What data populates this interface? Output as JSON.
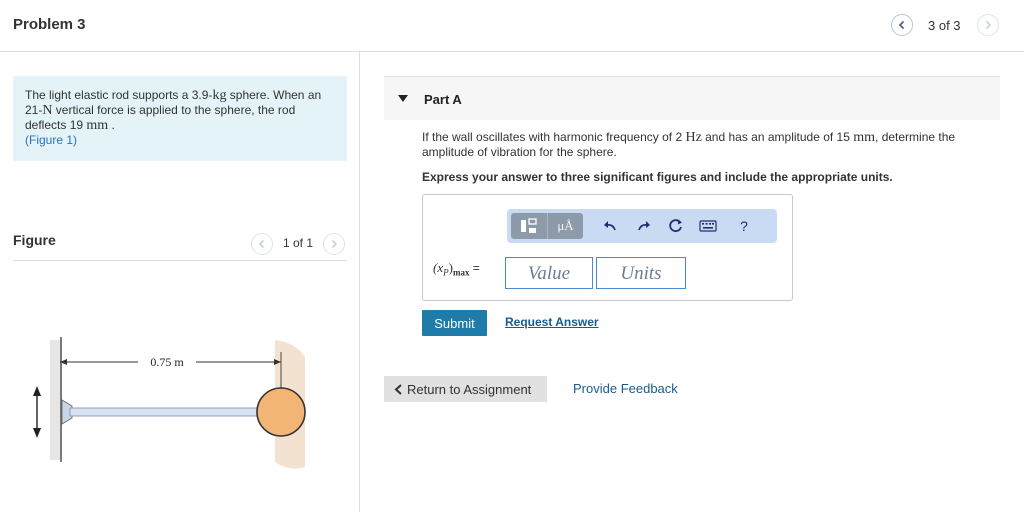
{
  "header": {
    "title": "Problem 3",
    "pager": "3 of 3"
  },
  "problem": {
    "line1_pre": "The light elastic rod supports a 3.9-",
    "line1_unit": "kg",
    "line1_post": " sphere. When an",
    "line2_pre": "21-",
    "line2_unit": "N",
    "line2_post": " vertical force is applied to the sphere, the rod",
    "line3_pre": "deflects 19 ",
    "line3_unit": "mm",
    "line3_post": " .",
    "figure_link": "(Figure 1)"
  },
  "figure": {
    "title": "Figure",
    "pager": "1 of 1",
    "dimension_label": "0.75 m"
  },
  "part": {
    "label": "Part A",
    "question_pre": "If the wall oscillates with harmonic frequency of 2 ",
    "question_unit1": "Hz",
    "question_mid": " and has an amplitude of 15 ",
    "question_unit2": "mm",
    "question_post": ", determine the",
    "question_line2": "amplitude of vibration for the sphere.",
    "instruction": "Express your answer to three significant figures and include the appropriate units."
  },
  "answer": {
    "variable_main": "(x",
    "variable_sub": "P",
    "variable_close": ")",
    "variable_subscript": "max",
    "equals": "=",
    "value_placeholder": "Value",
    "units_placeholder": "Units",
    "toolbar": {
      "mu_label": "μÅ",
      "help_label": "?"
    }
  },
  "actions": {
    "submit": "Submit",
    "request_answer": "Request Answer",
    "return": "Return to Assignment",
    "feedback": "Provide Feedback"
  }
}
